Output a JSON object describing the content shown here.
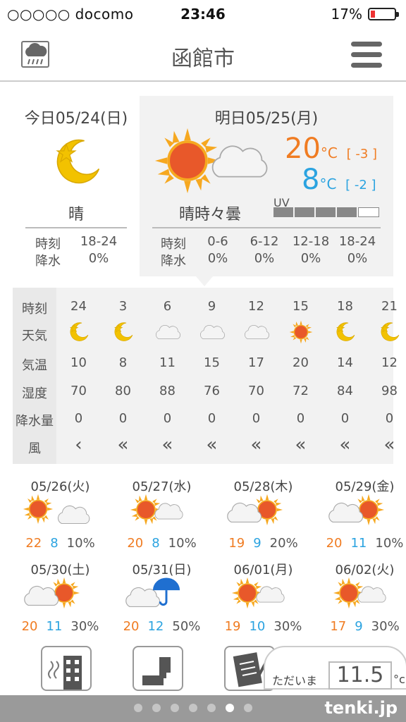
{
  "status": {
    "carrier": "○○○○○ docomo",
    "time": "23:46",
    "battery": "17%"
  },
  "header": {
    "title": "函館市",
    "radar_icon": "rain-cloud-icon",
    "menu_icon": "hamburger-menu-icon"
  },
  "today": {
    "date": "今日05/24(日)",
    "weather": "晴",
    "icon": "moon-star-icon",
    "table": {
      "time_label": "時刻",
      "time": "18-24",
      "rain_label": "降水",
      "rain": "0%"
    }
  },
  "tomorrow": {
    "date": "明日05/25(月)",
    "weather": "晴時々曇",
    "icon": "sun-cloud-icon",
    "high": "20",
    "high_diff": "[ -3 ]",
    "low": "8",
    "low_diff": "[ -2 ]",
    "unit": "°C",
    "uv_label": "UV",
    "uv_level": 4,
    "table": {
      "time_label": "時刻",
      "rain_label": "降水",
      "times": [
        "0-6",
        "6-12",
        "12-18",
        "18-24"
      ],
      "rain": [
        "0%",
        "0%",
        "0%",
        "0%"
      ]
    }
  },
  "hourly": {
    "labels": [
      "時刻",
      "天気",
      "気温",
      "湿度",
      "降水量",
      "風"
    ],
    "hours": [
      "24",
      "3",
      "6",
      "9",
      "12",
      "15",
      "18",
      "21"
    ],
    "weather": [
      "moon-star-icon",
      "moon-star-icon",
      "cloud-icon",
      "cloud-icon",
      "cloud-icon",
      "sun-icon",
      "moon-star-icon",
      "moon-star-icon"
    ],
    "temp": [
      "10",
      "8",
      "11",
      "15",
      "17",
      "20",
      "14",
      "12"
    ],
    "humidity": [
      "70",
      "80",
      "88",
      "76",
      "70",
      "72",
      "84",
      "98"
    ],
    "precip": [
      "0",
      "0",
      "0",
      "0",
      "0",
      "0",
      "0",
      "0"
    ],
    "wind": [
      "‹",
      "«",
      "«",
      "«",
      "«",
      "«",
      "«",
      "«"
    ]
  },
  "weekly": [
    {
      "date": "05/26(火)",
      "high": "22",
      "low": "8",
      "pop": "10%",
      "icon": "sun-then-cloud-icon"
    },
    {
      "date": "05/27(水)",
      "high": "20",
      "low": "8",
      "pop": "10%",
      "icon": "sun-cloud-icon"
    },
    {
      "date": "05/28(木)",
      "high": "19",
      "low": "9",
      "pop": "20%",
      "icon": "cloud-sun-icon"
    },
    {
      "date": "05/29(金)",
      "high": "20",
      "low": "11",
      "pop": "10%",
      "icon": "cloud-sun-icon"
    },
    {
      "date": "05/30(土)",
      "high": "20",
      "low": "11",
      "pop": "30%",
      "icon": "cloud-sun-icon"
    },
    {
      "date": "05/31(日)",
      "high": "20",
      "low": "12",
      "pop": "50%",
      "icon": "cloud-umbrella-icon"
    },
    {
      "date": "06/01(月)",
      "high": "19",
      "low": "10",
      "pop": "30%",
      "icon": "sun-cloud-icon"
    },
    {
      "date": "06/02(火)",
      "high": "17",
      "low": "9",
      "pop": "30%",
      "icon": "sun-cloud-icon"
    }
  ],
  "current": {
    "label": "ただいま",
    "temp": "11.5",
    "unit": "°c"
  },
  "footer": {
    "brand": "tenki.jp"
  },
  "colors": {
    "high": "#f07c22",
    "low": "#2ba3e0",
    "sun": "#e8582a",
    "moon": "#f2c200"
  }
}
